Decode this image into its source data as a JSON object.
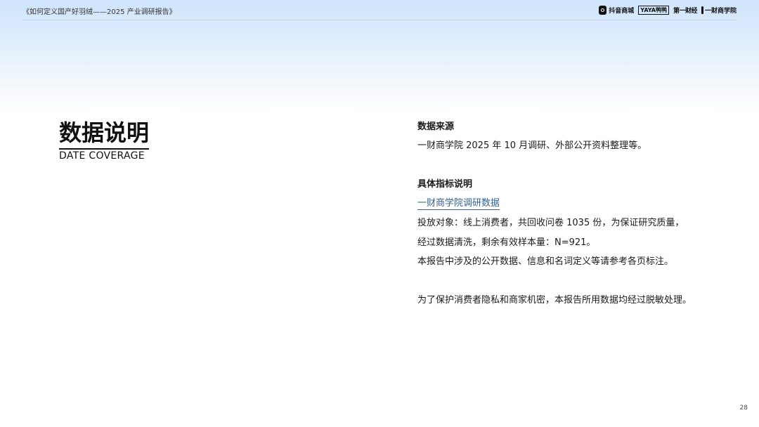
{
  "header": {
    "report_title": "《如何定义国产好羽绒——2025 产业调研报告》",
    "logos": {
      "douyin": "抖音商城",
      "yaya": "YAYA鸭鸭",
      "diyi": "第一财经",
      "yicai": "一财商学院"
    }
  },
  "section": {
    "title": "数据说明",
    "subtitle": "DATE COVERAGE"
  },
  "content": {
    "source_heading": "数据来源",
    "source_text": "一财商学院 2025 年 10 月调研、外部公开资料整理等。",
    "indicator_heading": "具体指标说明",
    "indicator_link": "一财商学院调研数据",
    "survey_line1": "投放对象：线上消费者，共回收问卷 1035 份，为保证研究质量，",
    "survey_line2": "经过数据清洗，剩余有效样本量：N=921。",
    "survey_line3": "本报告中涉及的公开数据、信息和名词定义等请参考各页标注。",
    "privacy_text": "为了保护消费者隐私和商家机密，本报告所用数据均经过脱敏处理。"
  },
  "page_number": "28"
}
